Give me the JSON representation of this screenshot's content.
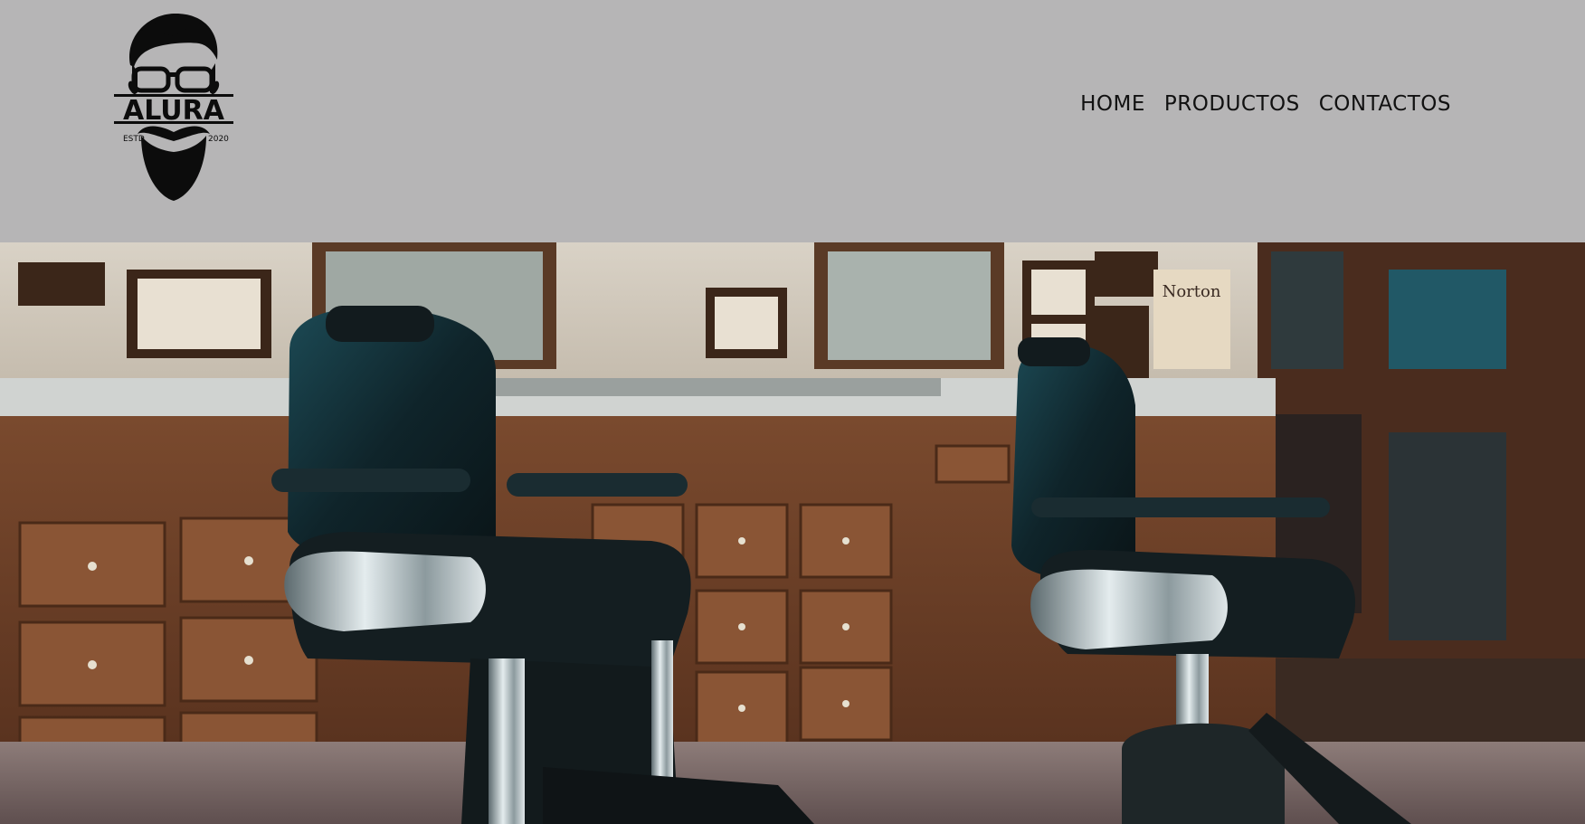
{
  "header": {
    "background_color": "#b6b5b6",
    "logo": {
      "icon": "bearded-man-glasses-logo-icon",
      "brand_text": "ALURA",
      "left_text": "ESTD",
      "right_text": "2020"
    },
    "nav": [
      {
        "label": "HOME"
      },
      {
        "label": "PRODUCTOS"
      },
      {
        "label": "CONTACTOS"
      }
    ]
  },
  "hero": {
    "image_subject": "barbershop interior with two vintage barber chairs and wooden drawers",
    "sign_text": "Norton"
  }
}
